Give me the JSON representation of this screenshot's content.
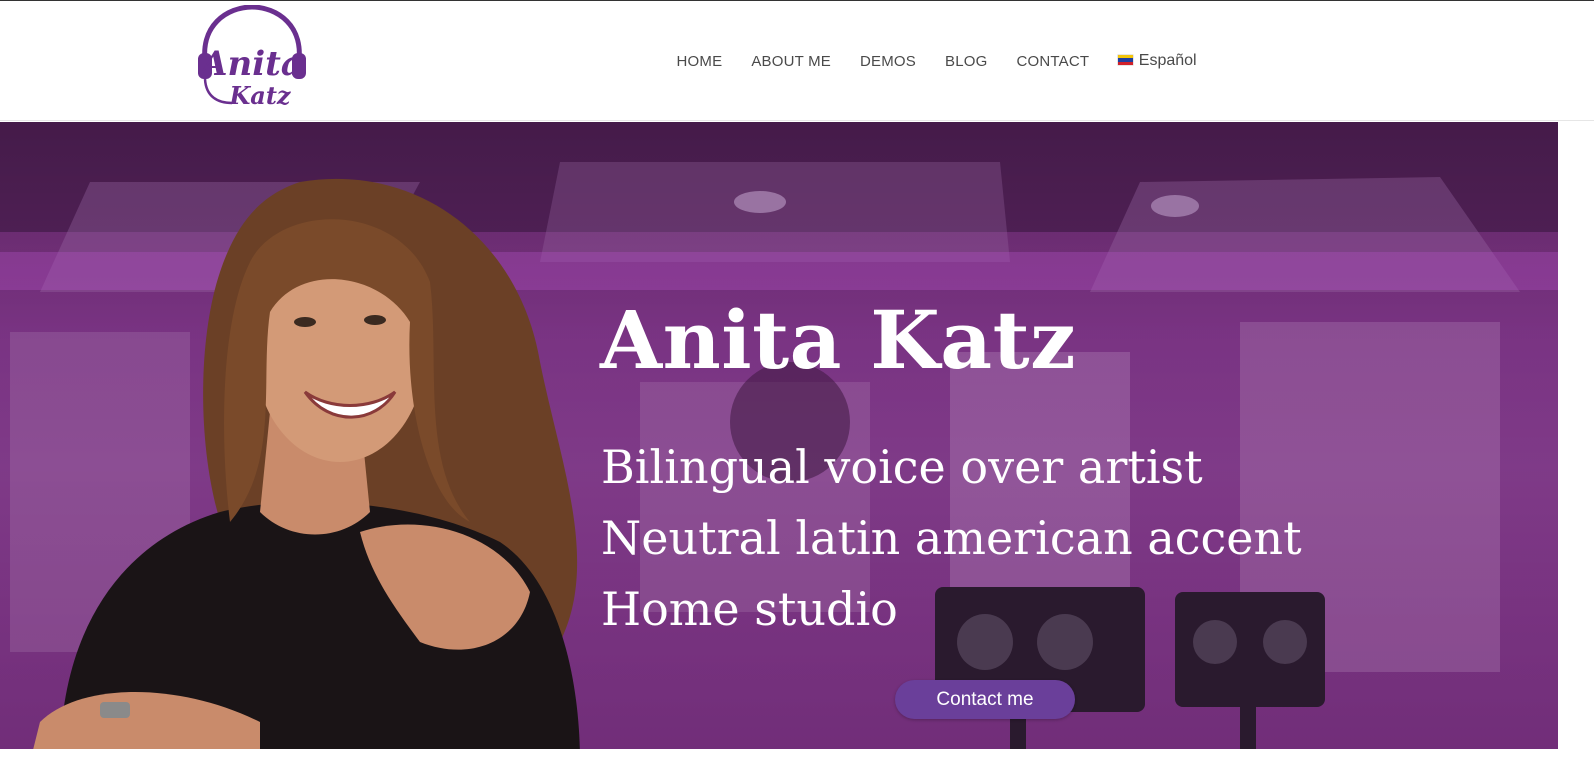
{
  "brand": {
    "logo_top": "Anita",
    "logo_bottom": "Katz",
    "accent_color": "#6a2f8f"
  },
  "nav": {
    "items": [
      {
        "label": "HOME"
      },
      {
        "label": "ABOUT ME"
      },
      {
        "label": "DEMOS"
      },
      {
        "label": "BLOG"
      },
      {
        "label": "CONTACT"
      }
    ],
    "language": {
      "label": "Español",
      "flag_icon": "venezuela-flag-icon"
    }
  },
  "hero": {
    "title": "Anita Katz",
    "lines": [
      "Bilingual voice over artist",
      "Neutral latin american accent",
      "Home studio"
    ],
    "cta_label": "Contact me",
    "cta_color": "#6a3f9a",
    "overlay_color": "#7a2d82"
  }
}
